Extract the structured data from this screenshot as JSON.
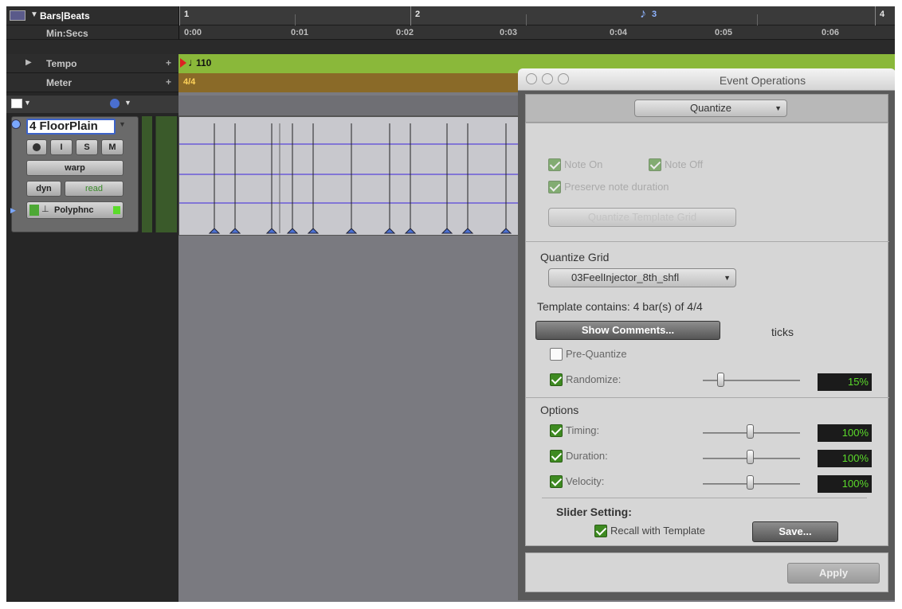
{
  "rulers": {
    "bars_beats": "Bars|Beats",
    "min_secs": "Min:Secs",
    "tempo": "Tempo",
    "meter": "Meter",
    "bars": [
      "1",
      "2",
      "4"
    ],
    "bar3": "3",
    "secs": [
      "0:00",
      "0:01",
      "0:02",
      "0:03",
      "0:04",
      "0:05",
      "0:06"
    ],
    "tempo_value": "110",
    "meter_value": "4/4"
  },
  "track": {
    "name": "4 FloorPlain",
    "record_label": "",
    "input_label": "I",
    "solo_label": "S",
    "mute_label": "M",
    "view_mode": "warp",
    "automation_label": "dyn",
    "automation_mode": "read",
    "voice_label": "Polyphnc"
  },
  "dialog": {
    "title": "Event Operations",
    "operation": "Quantize",
    "note_on": "Note On",
    "note_off": "Note Off",
    "preserve": "Preserve note duration",
    "disabled_btn": "Quantize Template Grid",
    "quantize_grid_label": "Quantize Grid",
    "grid_value": "03FeelInjector_8th_shfl",
    "template_info": "Template contains: 4 bar(s) of 4/4",
    "show_comments": "Show Comments...",
    "ticks": "ticks",
    "pre_quantize": "Pre-Quantize",
    "randomize": "Randomize:",
    "randomize_value": "15%",
    "randomize_level": 0.15,
    "options_label": "Options",
    "timing": "Timing:",
    "timing_value": "100%",
    "duration": "Duration:",
    "duration_value": "100%",
    "velocity": "Velocity:",
    "velocity_value": "100%",
    "slider_setting": "Slider Setting:",
    "recall": "Recall with Template",
    "save": "Save...",
    "apply": "Apply"
  },
  "colors": {
    "tempo_lane": "#8ab83a",
    "meter_lane": "#8a6a28",
    "value_text": "#5bdb2b",
    "checkbox_on": "#3e8a21"
  }
}
